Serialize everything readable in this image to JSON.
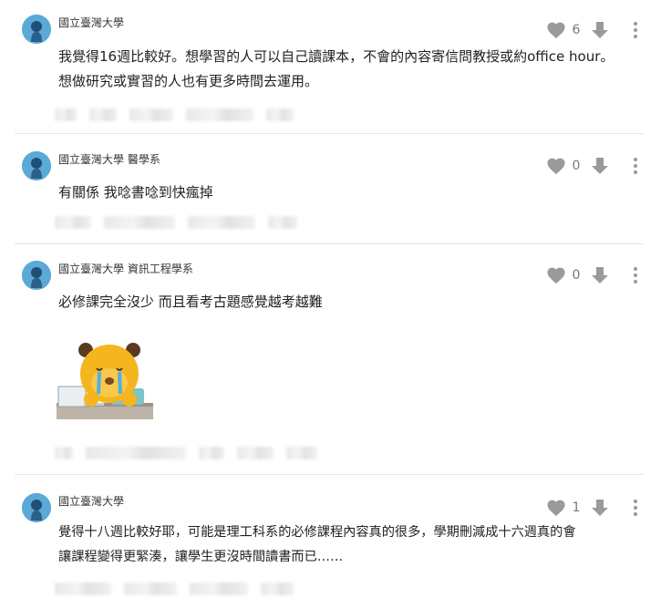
{
  "comments": [
    {
      "author": "國立臺灣大學",
      "body_line1": "我覺得16週比較好。想學習的人可以自己讀課本，不會的內容寄信問教授或約office hour。",
      "body_line2": "想做研究或實習的人也有更多時間去運用。",
      "likes": "6"
    },
    {
      "author": "國立臺灣大學 醫學系",
      "body_line1": "有關係 我唸書唸到快瘋掉",
      "likes": "0"
    },
    {
      "author": "國立臺灣大學 資訊工程學系",
      "body_line1": "必修課完全沒少 而且看考古題感覺越考越難",
      "likes": "0",
      "sticker": "crying-bear-at-laptop"
    },
    {
      "author": "國立臺灣大學",
      "body_line1": "覺得十八週比較好耶，可能是理工科系的必修課程內容真的很多，學期刪減成十六週真的會",
      "body_line2": "讓課程變得更緊湊，讓學生更沒時間讀書而已……",
      "likes": "1"
    }
  ],
  "colors": {
    "avatar": "#5aa9d6",
    "icon_gray": "#9a9a9a",
    "divider": "#e6e6e6"
  },
  "icons": [
    "heart-icon",
    "thumb-down-arrow-icon",
    "more-vertical-icon",
    "avatar-icon"
  ]
}
